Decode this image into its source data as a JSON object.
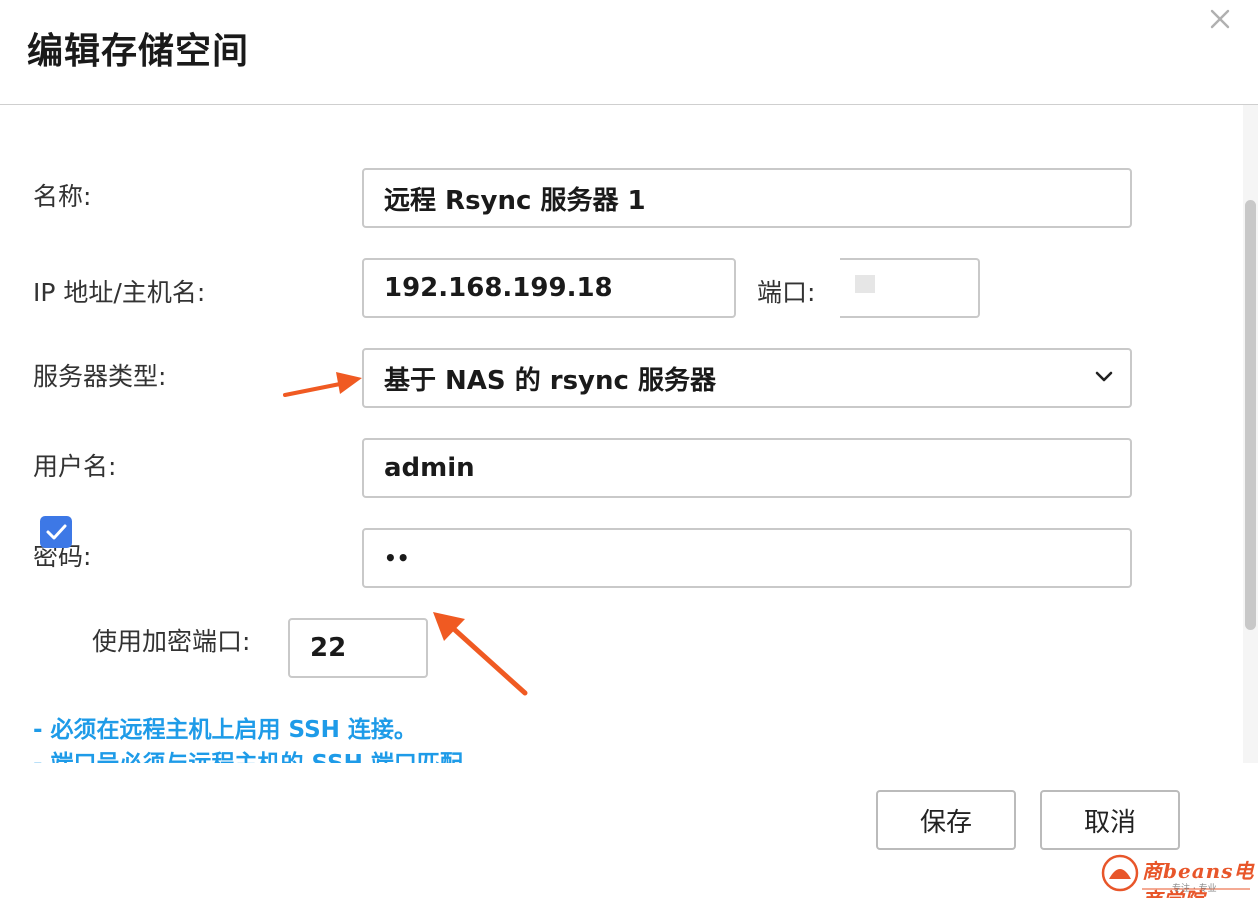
{
  "dialog": {
    "title": "编辑存储空间",
    "close_icon": "close-icon"
  },
  "form": {
    "name": {
      "label": "名称:",
      "value": "远程 Rsync 服务器 1"
    },
    "host": {
      "label": "IP 地址/主机名:",
      "value": "192.168.199.18"
    },
    "port": {
      "label": "端口:",
      "value": ""
    },
    "server_type": {
      "label": "服务器类型:",
      "value": "基于 NAS 的 rsync 服务器",
      "icon": "chevron-down-icon"
    },
    "username": {
      "label": "用户名:",
      "value": "admin"
    },
    "password": {
      "label": "密码:",
      "value": "••"
    },
    "encrypted_port": {
      "label": "使用加密端口:",
      "checked": true,
      "value": "22"
    }
  },
  "notes": [
    "- 必须在远程主机上启用 SSH 连接。",
    "- 端口号必须与远程主机的 SSH 端口匹配"
  ],
  "footer": {
    "save_label": "保存",
    "cancel_label": "取消"
  },
  "watermark": {
    "text": "商beans电商学院",
    "sub": "专注 · 专业"
  },
  "colors": {
    "accent": "#3d78e6",
    "note": "#1e9be8",
    "annotation_arrow": "#f05a22"
  }
}
